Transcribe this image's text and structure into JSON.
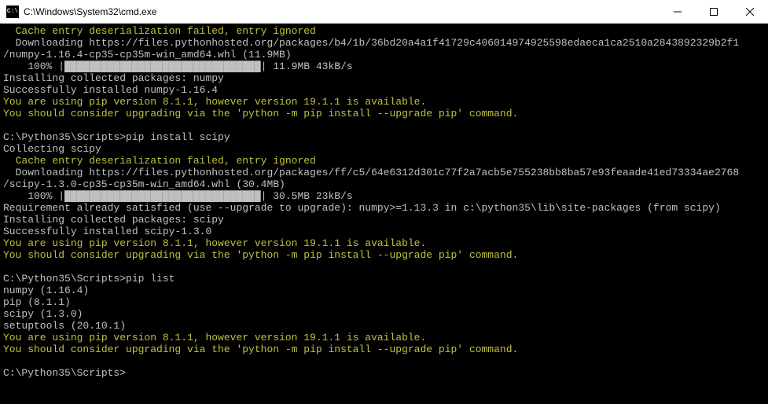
{
  "titlebar": {
    "icon_text": "C:\\",
    "title": "C:\\Windows\\System32\\cmd.exe"
  },
  "terminal": {
    "lines": [
      {
        "cls": "t-yellow indent2",
        "text": "Cache entry deserialization failed, entry ignored"
      },
      {
        "cls": "t-white indent2",
        "text": "Downloading https://files.pythonhosted.org/packages/b4/1b/36bd20a4a1f41729c406014974925598edaeca1ca2510a2843892329b2f1"
      },
      {
        "cls": "t-white",
        "text": "/numpy-1.16.4-cp35-cp35m-win_amd64.whl (11.9MB)"
      },
      {
        "cls": "t-white indent4",
        "text": "100% |████████████████████████████████| 11.9MB 43kB/s"
      },
      {
        "cls": "t-white",
        "text": "Installing collected packages: numpy"
      },
      {
        "cls": "t-white",
        "text": "Successfully installed numpy-1.16.4"
      },
      {
        "cls": "t-yellow",
        "text": "You are using pip version 8.1.1, however version 19.1.1 is available."
      },
      {
        "cls": "t-yellow",
        "text": "You should consider upgrading via the 'python -m pip install --upgrade pip' command."
      },
      {
        "cls": "t-white",
        "text": " "
      },
      {
        "cls": "t-white",
        "text": "C:\\Python35\\Scripts>pip install scipy"
      },
      {
        "cls": "t-white",
        "text": "Collecting scipy"
      },
      {
        "cls": "t-yellow indent2",
        "text": "Cache entry deserialization failed, entry ignored"
      },
      {
        "cls": "t-white indent2",
        "text": "Downloading https://files.pythonhosted.org/packages/ff/c5/64e6312d301c77f2a7acb5e755238bb8ba57e93feaade41ed73334ae2768"
      },
      {
        "cls": "t-white",
        "text": "/scipy-1.3.0-cp35-cp35m-win_amd64.whl (30.4MB)"
      },
      {
        "cls": "t-white indent4",
        "text": "100% |████████████████████████████████| 30.5MB 23kB/s"
      },
      {
        "cls": "t-white",
        "text": "Requirement already satisfied (use --upgrade to upgrade): numpy>=1.13.3 in c:\\python35\\lib\\site-packages (from scipy)"
      },
      {
        "cls": "t-white",
        "text": "Installing collected packages: scipy"
      },
      {
        "cls": "t-white",
        "text": "Successfully installed scipy-1.3.0"
      },
      {
        "cls": "t-yellow",
        "text": "You are using pip version 8.1.1, however version 19.1.1 is available."
      },
      {
        "cls": "t-yellow",
        "text": "You should consider upgrading via the 'python -m pip install --upgrade pip' command."
      },
      {
        "cls": "t-white",
        "text": " "
      },
      {
        "cls": "t-white",
        "text": "C:\\Python35\\Scripts>pip list"
      },
      {
        "cls": "t-white",
        "text": "numpy (1.16.4)"
      },
      {
        "cls": "t-white",
        "text": "pip (8.1.1)"
      },
      {
        "cls": "t-white",
        "text": "scipy (1.3.0)"
      },
      {
        "cls": "t-white",
        "text": "setuptools (20.10.1)"
      },
      {
        "cls": "t-yellow",
        "text": "You are using pip version 8.1.1, however version 19.1.1 is available."
      },
      {
        "cls": "t-yellow",
        "text": "You should consider upgrading via the 'python -m pip install --upgrade pip' command."
      },
      {
        "cls": "t-white",
        "text": " "
      },
      {
        "cls": "t-white",
        "text": "C:\\Python35\\Scripts>"
      }
    ]
  }
}
